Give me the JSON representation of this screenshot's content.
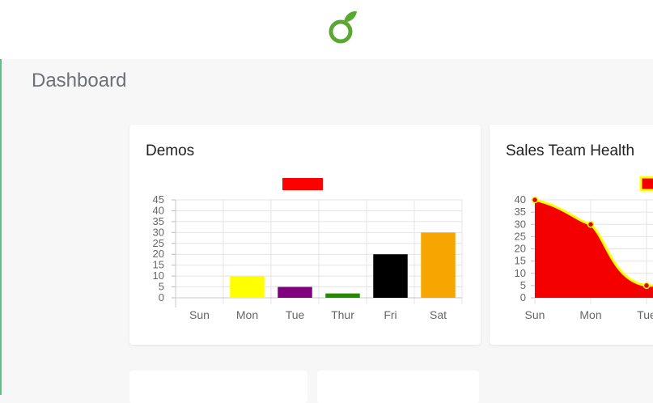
{
  "page": {
    "title": "Dashboard"
  },
  "logo": {
    "icon": "odoo-leaf-logo",
    "color": "#5aa832"
  },
  "cards": [
    {
      "title": "Demos",
      "chart_data": {
        "type": "bar",
        "categories": [
          "Sun",
          "Mon",
          "Tue",
          "Thur",
          "Fri",
          "Sat"
        ],
        "values": [
          0,
          10,
          5,
          2,
          20,
          30
        ],
        "colors": [
          "#ff0000",
          "#ffff00",
          "#800080",
          "#228b00",
          "#000000",
          "#f7a500"
        ],
        "legend_color": "#ff0000",
        "legend_placement": "top-center",
        "ylim": [
          0,
          45
        ],
        "yticks": [
          "45",
          "40",
          "35",
          "30",
          "25",
          "20",
          "15",
          "10",
          "5",
          "0"
        ],
        "grid": true
      }
    },
    {
      "title": "Sales Team Health",
      "chart_data": {
        "type": "area",
        "categories": [
          "Sun",
          "Mon",
          "Tue"
        ],
        "values": [
          40,
          30,
          5
        ],
        "fill": "#f50000",
        "line_color": "#ffff00",
        "point_color": "#dd0000",
        "legend_placement": "top-right",
        "ylim": [
          0,
          40
        ],
        "yticks": [
          "40",
          "35",
          "30",
          "25",
          "20",
          "15",
          "10",
          "5",
          "0"
        ],
        "grid": true
      }
    }
  ]
}
